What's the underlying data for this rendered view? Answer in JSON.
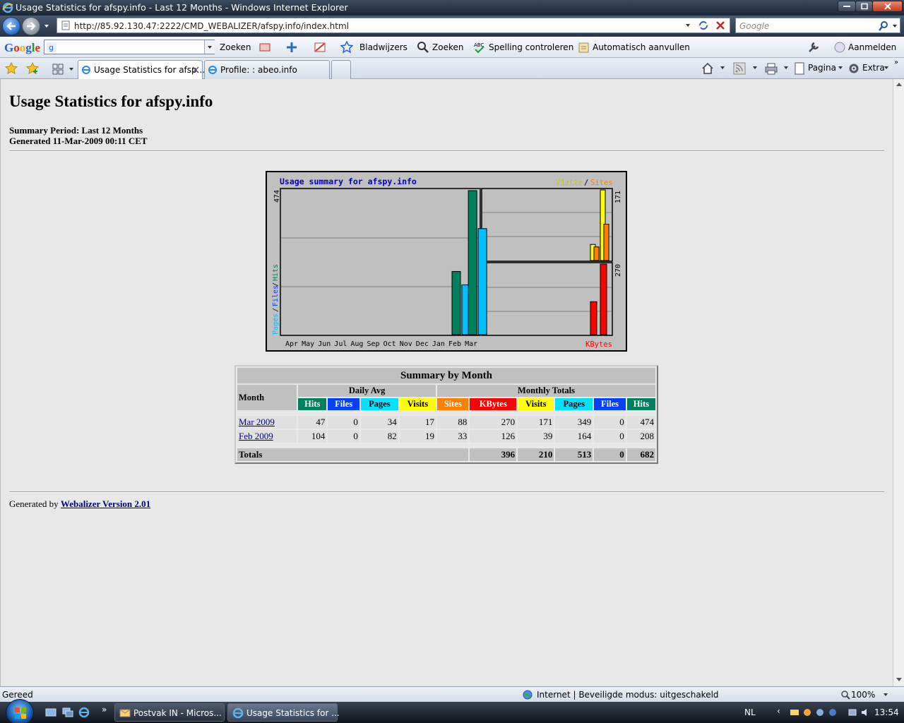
{
  "window": {
    "title": "Usage Statistics for afspy.info - Last 12 Months - Windows Internet Explorer"
  },
  "address_bar": {
    "url": "http://85.92.130.47:2222/CMD_WEBALIZER/afspy.info/index.html",
    "search_placeholder": "Google"
  },
  "google_toolbar": {
    "search_button": "Zoeken",
    "bookmarks": "Bladwijzers",
    "zoeken": "Zoeken",
    "spellcheck": "Spelling controleren",
    "autofill": "Automatisch aanvullen",
    "signin": "Aanmelden"
  },
  "tabs": [
    {
      "label": "Usage Statistics for afsp..."
    },
    {
      "label": "Profile: : abeo.info"
    }
  ],
  "command_bar": {
    "page": "Pagina",
    "extra": "Extra"
  },
  "page": {
    "title": "Usage Statistics for afspy.info",
    "summary_period": "Summary Period: Last 12 Months",
    "generated": "Generated 11-Mar-2009 00:11 CET"
  },
  "chart_data": {
    "type": "bar",
    "title": "Usage summary for afspy.info",
    "categories": [
      "Apr",
      "May",
      "Jun",
      "Jul",
      "Aug",
      "Sep",
      "Oct",
      "Nov",
      "Dec",
      "Jan",
      "Feb",
      "Mar"
    ],
    "left_panel": {
      "ylabel_parts": [
        "Pages",
        "Files",
        "Hits"
      ],
      "max_label": "474",
      "ymax": 474,
      "series": [
        {
          "name": "Hits",
          "color": "#00805c",
          "values": [
            0,
            0,
            0,
            0,
            0,
            0,
            0,
            0,
            0,
            0,
            208,
            474
          ]
        },
        {
          "name": "Files",
          "color": "#0040ff",
          "values": [
            0,
            0,
            0,
            0,
            0,
            0,
            0,
            0,
            0,
            0,
            0,
            0
          ]
        },
        {
          "name": "Pages",
          "color": "#00c0ff",
          "values": [
            0,
            0,
            0,
            0,
            0,
            0,
            0,
            0,
            0,
            0,
            164,
            349
          ]
        }
      ]
    },
    "right_top_panel": {
      "legend_parts": [
        "Visits",
        "Sites"
      ],
      "max_label": "171",
      "ymax": 171,
      "series": [
        {
          "name": "Visits",
          "color": "#ffff00",
          "values": [
            39,
            171
          ]
        },
        {
          "name": "Sites",
          "color": "#ff8000",
          "values": [
            33,
            88
          ]
        }
      ]
    },
    "right_bottom_panel": {
      "legend": "KBytes",
      "max_label": "270",
      "ymax": 270,
      "series": [
        {
          "name": "KBytes",
          "color": "#ff0000",
          "values": [
            126,
            270
          ]
        }
      ]
    }
  },
  "summary_table": {
    "caption": "Summary by Month",
    "month_header": "Month",
    "daily_avg_header": "Daily Avg",
    "monthly_totals_header": "Monthly Totals",
    "columns": [
      {
        "label": "Hits",
        "color": "#00805c"
      },
      {
        "label": "Files",
        "color": "#0040ff"
      },
      {
        "label": "Pages",
        "color": "#00e0ff"
      },
      {
        "label": "Visits",
        "color": "#ffff00"
      },
      {
        "label": "Sites",
        "color": "#ff8000"
      },
      {
        "label": "KBytes",
        "color": "#ff0000"
      },
      {
        "label": "Visits",
        "color": "#ffff00"
      },
      {
        "label": "Pages",
        "color": "#00e0ff"
      },
      {
        "label": "Files",
        "color": "#0040ff"
      },
      {
        "label": "Hits",
        "color": "#00805c"
      }
    ],
    "rows": [
      {
        "month": "Mar 2009",
        "values": [
          "47",
          "0",
          "34",
          "17",
          "88",
          "270",
          "171",
          "349",
          "0",
          "474"
        ]
      },
      {
        "month": "Feb 2009",
        "values": [
          "104",
          "0",
          "82",
          "19",
          "33",
          "126",
          "39",
          "164",
          "0",
          "208"
        ]
      }
    ],
    "totals_label": "Totals",
    "totals": [
      "396",
      "210",
      "513",
      "0",
      "682"
    ]
  },
  "footer": {
    "prefix": "Generated by",
    "link": "Webalizer Version 2.01"
  },
  "status_bar": {
    "left": "Gereed",
    "zone": "Internet | Beveiligde modus: uitgeschakeld",
    "zoom": "100%"
  },
  "taskbar": {
    "buttons": [
      {
        "label": "Postvak IN - Micros..."
      },
      {
        "label": "Usage Statistics for ..."
      }
    ],
    "language": "NL",
    "clock": "13:54"
  }
}
